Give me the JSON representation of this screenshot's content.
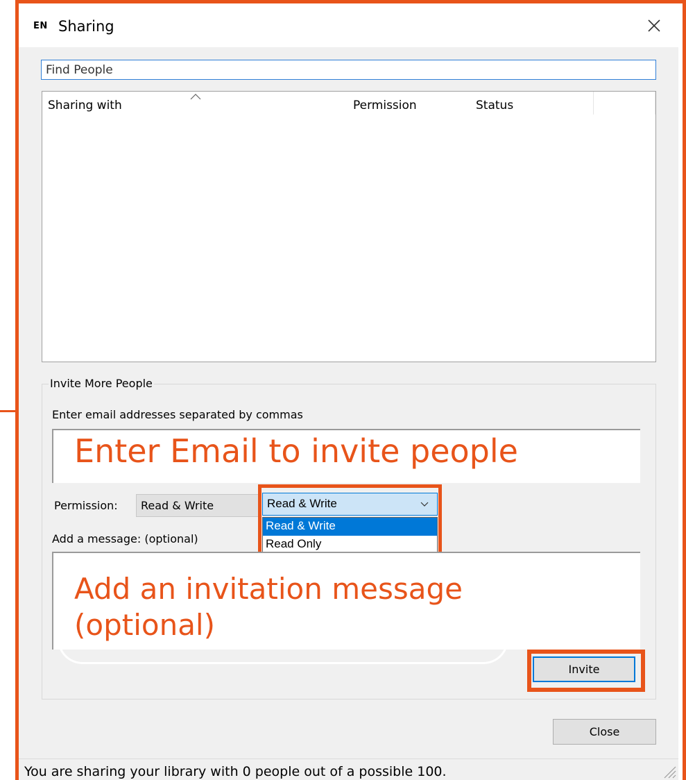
{
  "window": {
    "app_icon": "EN",
    "title": "Sharing",
    "close_icon": "close-icon"
  },
  "find_people": {
    "value": "",
    "placeholder": "Find People"
  },
  "sharing_list": {
    "columns": [
      "Sharing with",
      "Permission",
      "Status",
      ""
    ],
    "sort_indicator": "chevron-up-icon",
    "rows": []
  },
  "invite": {
    "group_title": "Invite More People",
    "email_hint": "Enter email addresses separated by commas",
    "email_annotation": "Enter Email to invite people",
    "permission_label": "Permission:",
    "permission_static_value": "Read & Write",
    "permission_combo_value": "Read & Write",
    "permission_options": [
      "Read & Write",
      "Read Only"
    ],
    "selected_option_index": 0,
    "message_label": "Add a message: (optional)",
    "message_annotation_line1": "Add an invitation message",
    "message_annotation_line2": "(optional)",
    "invite_button": "Invite"
  },
  "footer": {
    "close_button": "Close",
    "status": "You are sharing your library with 0 people out of a possible 100."
  },
  "colors": {
    "annotation": "#e8541a",
    "selection": "#0078d7",
    "combo_focus": "#cce4f7",
    "dialog_bg": "#f0f0f0"
  }
}
